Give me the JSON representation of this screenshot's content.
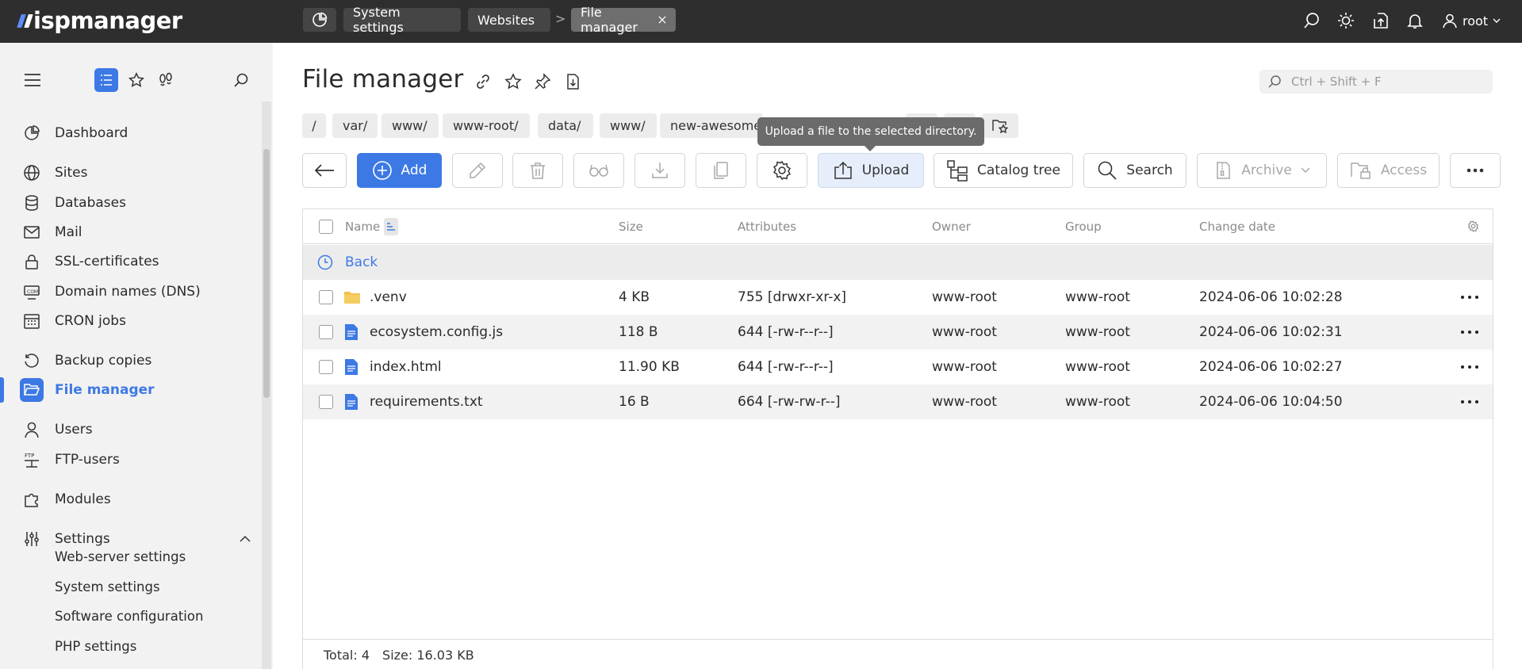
{
  "app": {
    "brand": "ispmanager"
  },
  "topbar": {
    "tabs": [
      {
        "label": "System settings"
      },
      {
        "label": "Websites"
      },
      {
        "label": "File manager"
      }
    ],
    "separator": ">",
    "user": "root"
  },
  "sidebar": {
    "items": [
      {
        "label": "Dashboard"
      },
      {
        "label": "Sites"
      },
      {
        "label": "Databases"
      },
      {
        "label": "Mail"
      },
      {
        "label": "SSL-certificates"
      },
      {
        "label": "Domain names (DNS)"
      },
      {
        "label": "CRON jobs"
      },
      {
        "label": "Backup copies"
      },
      {
        "label": "File manager"
      },
      {
        "label": "Users"
      },
      {
        "label": "FTP-users"
      },
      {
        "label": "Modules"
      },
      {
        "label": "Settings"
      }
    ],
    "settings_sub": [
      {
        "label": "Web-server settings"
      },
      {
        "label": "System settings"
      },
      {
        "label": "Software configuration"
      },
      {
        "label": "PHP settings"
      }
    ]
  },
  "page": {
    "title": "File manager",
    "search_placeholder": "Ctrl + Shift + F"
  },
  "breadcrumbs": [
    "/",
    "var/",
    "www/",
    "www-root/",
    "data/",
    "www/",
    "new-awesome"
  ],
  "tooltip": "Upload a file to the selected directory.",
  "toolbar": {
    "add": "Add",
    "upload": "Upload",
    "catalog_tree": "Catalog tree",
    "search": "Search",
    "archive": "Archive",
    "access": "Access"
  },
  "table": {
    "columns": {
      "name": "Name",
      "size": "Size",
      "attributes": "Attributes",
      "owner": "Owner",
      "group": "Group",
      "change_date": "Change date"
    },
    "back": "Back",
    "rows": [
      {
        "name": ".venv",
        "type": "folder",
        "size": "4 KB",
        "attributes": "755 [drwxr-xr-x]",
        "owner": "www-root",
        "group": "www-root",
        "date": "2024-06-06 10:02:28"
      },
      {
        "name": "ecosystem.config.js",
        "type": "file",
        "size": "118 B",
        "attributes": "644 [-rw-r--r--]",
        "owner": "www-root",
        "group": "www-root",
        "date": "2024-06-06 10:02:31"
      },
      {
        "name": "index.html",
        "type": "file",
        "size": "11.90 KB",
        "attributes": "644 [-rw-r--r--]",
        "owner": "www-root",
        "group": "www-root",
        "date": "2024-06-06 10:02:27"
      },
      {
        "name": "requirements.txt",
        "type": "file",
        "size": "16 B",
        "attributes": "664 [-rw-rw-r--]",
        "owner": "www-root",
        "group": "www-root",
        "date": "2024-06-06 10:04:50"
      }
    ],
    "footer": {
      "total": "Total: 4",
      "size": "Size: 16.03 KB"
    }
  },
  "colors": {
    "accent": "#3d79e5",
    "topbar": "#2e2e2e",
    "sidebar": "#f2f2f2"
  }
}
